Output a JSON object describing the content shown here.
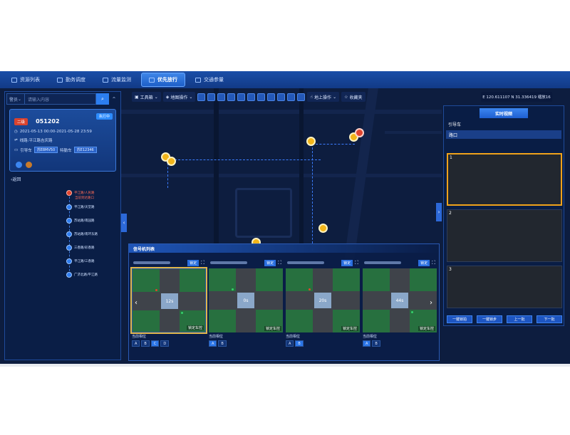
{
  "nav": {
    "tabs": [
      {
        "label": "资源列表",
        "active": false
      },
      {
        "label": "勤务调度",
        "active": false
      },
      {
        "label": "流量监测",
        "active": false
      },
      {
        "label": "优先放行",
        "active": true
      },
      {
        "label": "交通参量",
        "active": false
      }
    ]
  },
  "toolbar": {
    "tools_label": "工具箱",
    "layer_label": "地图操作",
    "upper_label": "地上操作",
    "favorites_label": "收藏夹",
    "coords": "E 120.611107 N 31.336419 缩放16"
  },
  "left_panel": {
    "select_label": "警员",
    "search_placeholder": "请输入内容",
    "card": {
      "tag": "二级",
      "id": "051202",
      "status": "执行中",
      "time_range": "2021-05-13 00:00-2021-05-28 23:59",
      "route": "线路:平江路吉庆路",
      "guide_car_label": "引导车",
      "guide_car_plate": "苏E8MV50",
      "escort_label": "特勤车",
      "escort_plate": "苏E12346"
    },
    "back_label": "返回",
    "timeline": [
      {
        "label": "平江路/人民路",
        "sublabel": "当前到达路口",
        "active": true
      },
      {
        "label": "平江路/天堂路",
        "active": false
      },
      {
        "label": "苏站路/南园路",
        "active": false
      },
      {
        "label": "苏站路/南环东路",
        "active": false
      },
      {
        "label": "三香路/彩香路",
        "active": false
      },
      {
        "label": "平江路/三香路",
        "active": false
      },
      {
        "label": "广济北路/平江路",
        "active": false
      }
    ]
  },
  "signal_panel": {
    "title": "信号机列表",
    "lock_label": "锁定",
    "mode_label": "锁定车控",
    "current_label": "当前相位",
    "cards": [
      {
        "timer": "12s",
        "selected": true,
        "phases": [
          "A",
          "B",
          "C",
          "D"
        ],
        "active_phase": "C"
      },
      {
        "timer": "0s",
        "selected": false,
        "phases": [
          "A",
          "B"
        ],
        "active_phase": "A"
      },
      {
        "timer": "20s",
        "selected": false,
        "phases": [
          "A",
          "B"
        ],
        "active_phase": "B"
      },
      {
        "timer": "44s",
        "selected": false,
        "phases": [
          "A",
          "B"
        ],
        "active_phase": "A"
      }
    ]
  },
  "right_panel": {
    "title": "实时视频",
    "guide_label": "引导车",
    "crossing_label": "路口",
    "videos": [
      {
        "num": "1",
        "selected": true
      },
      {
        "num": "2",
        "selected": false
      },
      {
        "num": "3",
        "selected": false
      }
    ],
    "buttons": [
      "一键锁拍",
      "一键锁步",
      "上一批",
      "下一批"
    ]
  },
  "colors": {
    "accent": "#2c7ef0",
    "panel_bg": "#0b1e48",
    "marker": "#f2b51a",
    "alert": "#e0442f"
  }
}
